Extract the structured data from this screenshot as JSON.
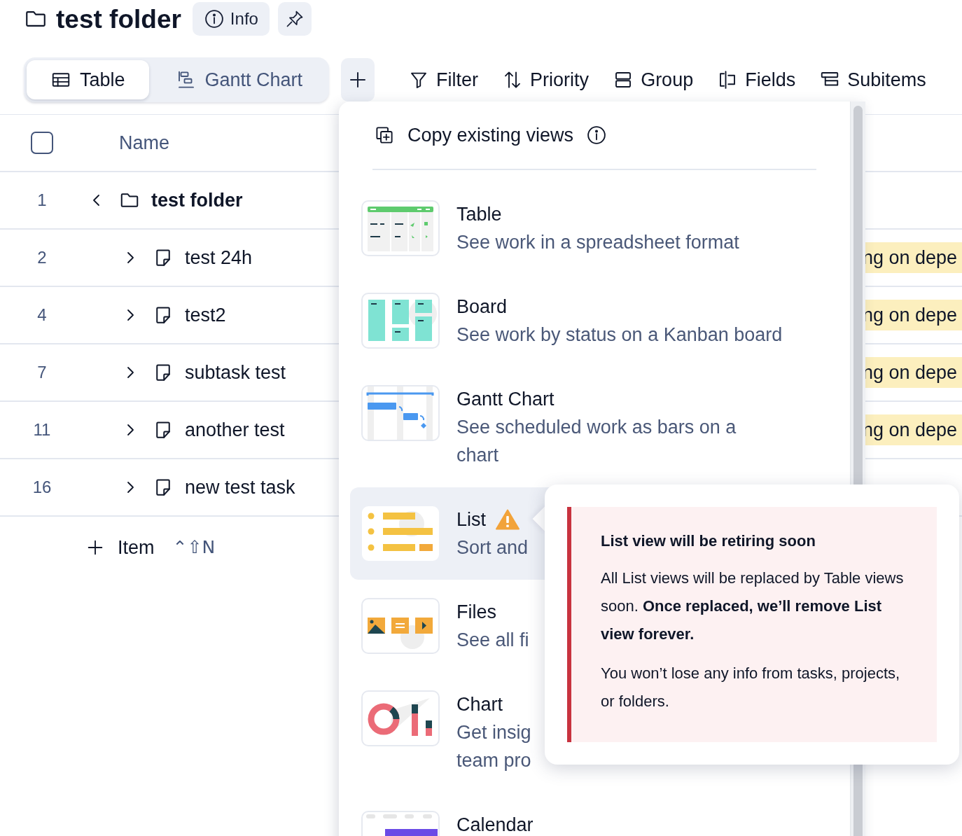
{
  "header": {
    "title": "test folder",
    "info_button": "Info"
  },
  "view_tabs": [
    {
      "label": "Table",
      "kind": "table",
      "selected": true
    },
    {
      "label": "Gantt Chart",
      "kind": "gantt",
      "selected": false
    }
  ],
  "toolbar": [
    {
      "label": "Filter",
      "kind": "filter"
    },
    {
      "label": "Priority",
      "kind": "sort"
    },
    {
      "label": "Group",
      "kind": "group"
    },
    {
      "label": "Fields",
      "kind": "fields"
    },
    {
      "label": "Subitems",
      "kind": "subitems"
    }
  ],
  "table": {
    "select_all": {
      "checked": false
    },
    "columns": [
      "Name"
    ],
    "rows": [
      {
        "number": "1",
        "kind": "folder",
        "name": "test folder",
        "children": [
          {
            "number": "2",
            "kind": "task",
            "name": "test 24h",
            "column_3": "ng on depe"
          },
          {
            "number": "4",
            "kind": "task",
            "name": "test2",
            "column_3": "ng on depe"
          },
          {
            "number": "7",
            "kind": "task",
            "name": "subtask test",
            "column_3": "ng on depe"
          },
          {
            "number": "11",
            "kind": "task",
            "name": "another test",
            "column_3": "ng on depe"
          },
          {
            "number": "16",
            "kind": "task",
            "name": "new test task"
          }
        ]
      }
    ],
    "add_item": {
      "label": "Item",
      "shortcut": "⌃⇧N"
    }
  },
  "views_menu": {
    "header": "Copy existing views",
    "items": [
      {
        "kind": "table",
        "title": "Table",
        "description_lines": [
          "See work in a spreadsheet format"
        ],
        "selected": false,
        "warning": false
      },
      {
        "kind": "board",
        "title": "Board",
        "description_lines": [
          "See work by status on a Kanban board"
        ],
        "selected": false,
        "warning": false
      },
      {
        "kind": "gantt",
        "title": "Gantt Chart",
        "description_lines": [
          "See scheduled work as bars on a",
          "chart"
        ],
        "selected": false,
        "warning": false
      },
      {
        "kind": "list",
        "title": "List",
        "description_lines": [
          "Sort and"
        ],
        "selected": true,
        "warning": true
      },
      {
        "kind": "files",
        "title": "Files",
        "description_lines": [
          "See all fi"
        ],
        "selected": false,
        "warning": false
      },
      {
        "kind": "chart",
        "title": "Chart",
        "description_lines": [
          "Get insig",
          "team pro"
        ],
        "selected": false,
        "warning": false
      },
      {
        "kind": "calendar",
        "title": "Calendar",
        "selected": false,
        "warning": false
      }
    ]
  },
  "tooltip": {
    "title": "List view will be retiring soon",
    "paragraphs": [
      "All List views will be replaced by Table views soon. **Once replaced, we’ll remove List view forever.**",
      "You won’t lose any info from tasks, projects, or folders."
    ]
  }
}
